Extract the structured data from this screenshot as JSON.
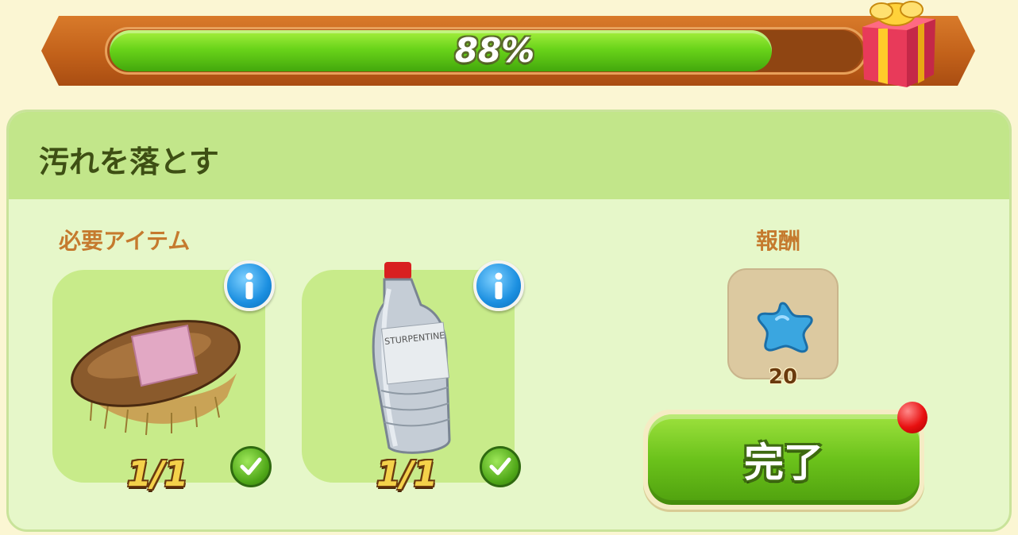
{
  "progress": {
    "label": "88%",
    "value": 0.88
  },
  "task": {
    "title": "汚れを落とす"
  },
  "required_items": {
    "label": "必要アイテム",
    "items": [
      {
        "name": "brush-item",
        "count": "1/1",
        "icon": "scrub-brush-icon"
      },
      {
        "name": "turpentine-bottle-item",
        "count": "1/1",
        "icon": "turpentine-bottle-icon",
        "bottle_label": "STURPENTINE"
      }
    ]
  },
  "reward": {
    "label": "報酬",
    "quantity": "20",
    "icon": "blue-star-icon"
  },
  "complete_button": {
    "label": "完了"
  },
  "colors": {
    "accent": "#6bc21b",
    "banner": "#c2611a",
    "panel": "#e6f7c9",
    "label": "#c57a2e"
  }
}
